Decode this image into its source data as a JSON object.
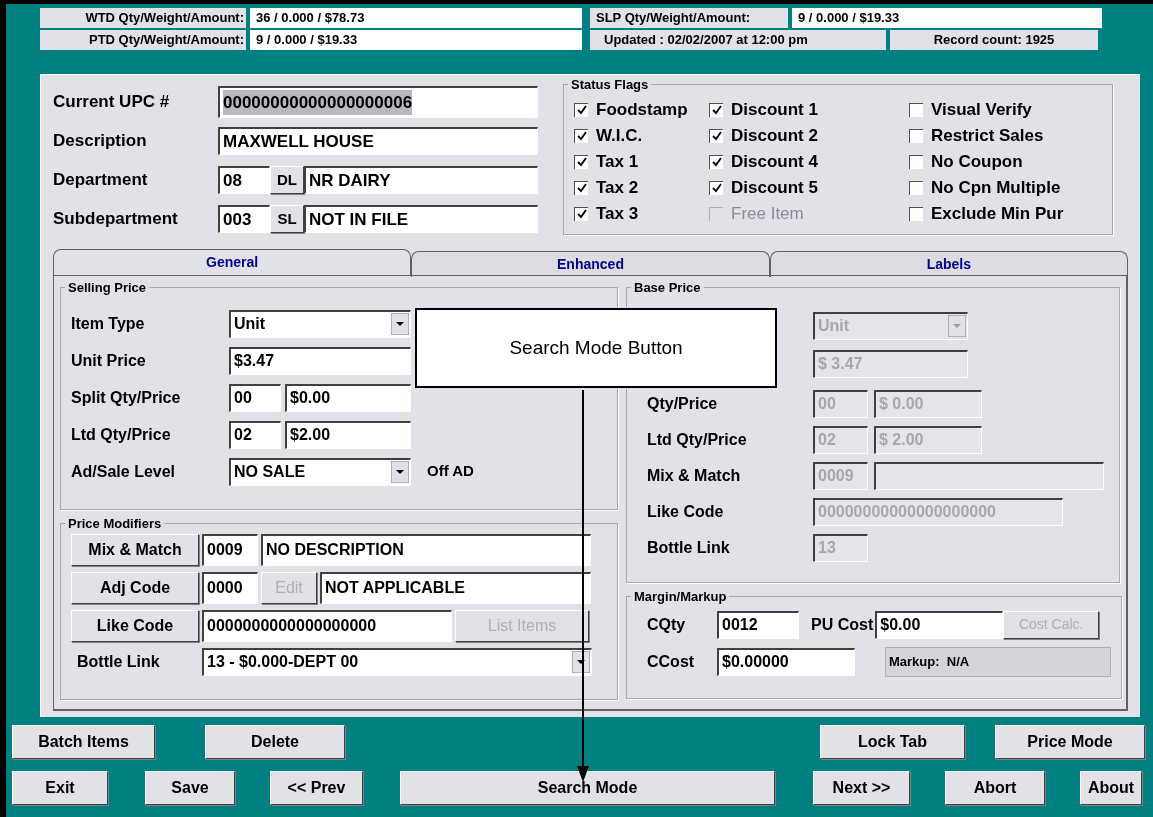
{
  "totals": [
    {
      "label": "WTD Qty/Weight/Amount:",
      "value": "36 / 0.000 / $78.73"
    },
    {
      "label": "SLP Qty/Weight/Amount:",
      "value": "9 / 0.000 / $19.33"
    },
    {
      "label": "PTD Qty/Weight/Amount:",
      "value": "9 / 0.000 / $19.33"
    }
  ],
  "updated": "Updated : 02/02/2007 at 12:00 pm",
  "record_count": "Record count: 1925",
  "item": {
    "upc": {
      "label": "Current UPC #",
      "value": "00000000000000000006"
    },
    "description": {
      "label": "Description",
      "value": "MAXWELL HOUSE"
    },
    "department": {
      "label": "Department",
      "code": "08",
      "button": "DL",
      "name": "NR DAIRY"
    },
    "subdepartment": {
      "label": "Subdepartment",
      "code": "003",
      "button": "SL",
      "name": "NOT IN FILE"
    }
  },
  "status_flags": {
    "title": "Status Flags",
    "items": [
      {
        "label": "Foodstamp",
        "checked": true,
        "disabled": false
      },
      {
        "label": "W.I.C.",
        "checked": true,
        "disabled": false
      },
      {
        "label": "Tax 1",
        "checked": true,
        "disabled": false
      },
      {
        "label": "Tax 2",
        "checked": true,
        "disabled": false
      },
      {
        "label": "Tax 3",
        "checked": true,
        "disabled": false
      },
      {
        "label": "Discount 1",
        "checked": true,
        "disabled": false
      },
      {
        "label": "Discount 2",
        "checked": true,
        "disabled": false
      },
      {
        "label": "Discount 4",
        "checked": true,
        "disabled": false
      },
      {
        "label": "Discount 5",
        "checked": true,
        "disabled": false
      },
      {
        "label": "Free Item",
        "checked": false,
        "disabled": true
      },
      {
        "label": "Visual Verify",
        "checked": false,
        "disabled": false
      },
      {
        "label": "Restrict Sales",
        "checked": false,
        "disabled": false
      },
      {
        "label": "No Coupon",
        "checked": false,
        "disabled": false
      },
      {
        "label": "No Cpn Multiple",
        "checked": false,
        "disabled": false
      },
      {
        "label": "Exclude Min Pur",
        "checked": false,
        "disabled": false
      }
    ]
  },
  "tabs": [
    {
      "label": "General",
      "selected": true
    },
    {
      "label": "Enhanced",
      "selected": false
    },
    {
      "label": "Labels",
      "selected": false
    }
  ],
  "selling_price": {
    "title": "Selling Price",
    "item_type": {
      "label": "Item Type",
      "value": "Unit"
    },
    "unit_price": {
      "label": "Unit Price",
      "value": "$3.47"
    },
    "split": {
      "label": "Split Qty/Price",
      "qty": "00",
      "price": "$0.00"
    },
    "ltd": {
      "label": "Ltd Qty/Price",
      "qty": "02",
      "price": "$2.00"
    },
    "ad_sale": {
      "label": "Ad/Sale Level",
      "value": "NO SALE",
      "note": "Off AD"
    }
  },
  "price_modifiers": {
    "title": "Price Modifiers",
    "mix_match": {
      "button": "Mix & Match",
      "code": "0009",
      "description": "NO DESCRIPTION"
    },
    "adj_code": {
      "button": "Adj Code",
      "code": "0000",
      "edit_button": {
        "label": "Edit",
        "disabled": true
      },
      "description": "NOT APPLICABLE"
    },
    "like_code": {
      "button": "Like Code",
      "value": "0000000000000000000",
      "list_button": {
        "label": "List Items",
        "disabled": true
      }
    },
    "bottle_link": {
      "label": "Bottle Link",
      "value": "13 - $0.000-DEPT 00"
    }
  },
  "base_price": {
    "title": "Base Price",
    "disabled": true,
    "item_type_value": "Unit",
    "unit_price_value": "$ 3.47",
    "qty_price": {
      "label": "Qty/Price",
      "qty": "00",
      "price": "$ 0.00"
    },
    "ltd": {
      "label": "Ltd Qty/Price",
      "qty": "02",
      "price": "$ 2.00"
    },
    "mix_match": {
      "label": "Mix & Match",
      "code": "0009"
    },
    "like_code": {
      "label": "Like Code",
      "value": "00000000000000000000"
    },
    "bottle_link": {
      "label": "Bottle Link",
      "value": "13"
    }
  },
  "margin": {
    "title": "Margin/Markup",
    "cqty": {
      "label": "CQty",
      "value": "0012"
    },
    "pu_cost": {
      "label": "PU Cost",
      "value": "$0.00"
    },
    "cost_calc_button": {
      "label": "Cost Calc.",
      "disabled": true
    },
    "ccost": {
      "label": "CCost",
      "value": "$0.00000"
    },
    "markup": "Markup:  N/A"
  },
  "buttons_row_1": [
    "Batch Items",
    "Delete",
    "Lock Tab",
    "Price Mode"
  ],
  "buttons_row_2": [
    "Exit",
    "Save",
    "<< Prev",
    "Search Mode",
    "Next >>",
    "Abort",
    "About"
  ],
  "callout": {
    "text": "Search Mode Button"
  }
}
